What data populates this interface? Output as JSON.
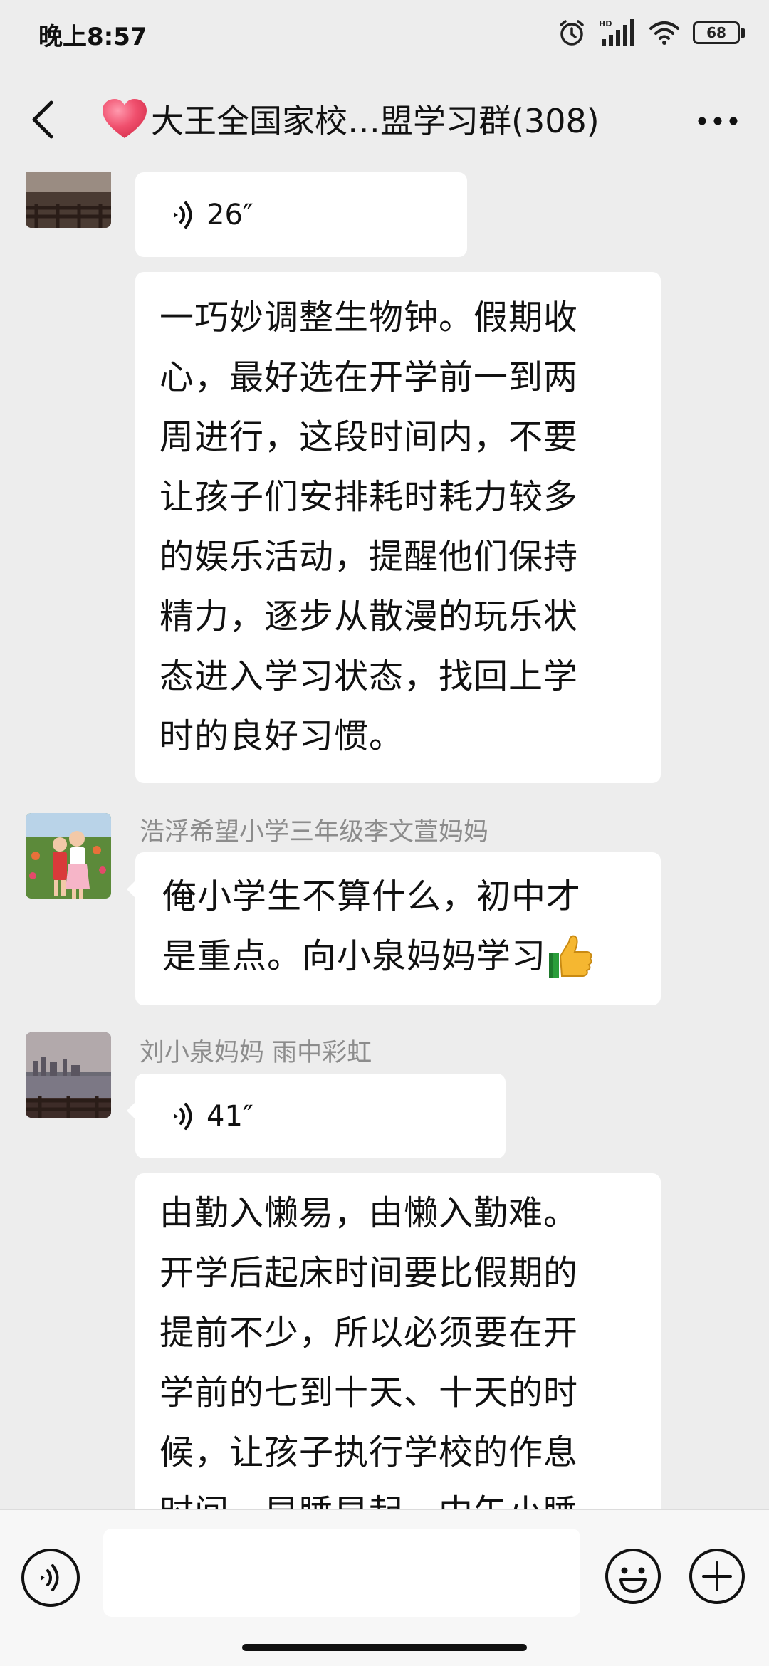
{
  "status_bar": {
    "time": "晚上8:57",
    "battery": "68",
    "icons": [
      "alarm-icon",
      "hd-signal-icon",
      "wifi-icon",
      "battery-icon"
    ]
  },
  "header": {
    "title": "大王全国家校…盟学习群(308)",
    "icons": [
      "back-icon",
      "heart-icon",
      "more-icon"
    ],
    "accent_color": "#f0506e"
  },
  "messages": [
    {
      "type": "voice",
      "duration": "26″"
    },
    {
      "type": "text",
      "lines": [
        "一巧妙调整生物钟。假期收",
        "心，最好选在开学前一到两",
        "周进行，这段时间内，不要",
        "让孩子们安排耗时耗力较多",
        "的娱乐活动，提醒他们保持",
        "精力，逐步从散漫的玩乐状",
        "态进入学习状态，找回上学",
        "时的良好习惯。"
      ]
    },
    {
      "type": "text",
      "sender": "浩浮希望小学三年级李文萱妈妈",
      "lines": [
        "俺小学生不算什么，初中才",
        "是重点。向小泉妈妈学习"
      ],
      "emoji": "thumbs-up-icon"
    },
    {
      "type": "voice",
      "sender": "刘小泉妈妈   雨中彩虹",
      "duration": "41″"
    },
    {
      "type": "text",
      "lines": [
        "由勤入懒易，由懒入勤难。",
        "开学后起床时间要比假期的",
        "提前不少，所以必须要在开",
        "学前的七到十天、十天的时",
        "候，让孩子执行学校的作息",
        "时间，早睡早起，中午小睡"
      ]
    }
  ],
  "input_bar": {
    "value": "",
    "icons": [
      "voice-input-icon",
      "emoji-icon",
      "plus-icon"
    ]
  }
}
